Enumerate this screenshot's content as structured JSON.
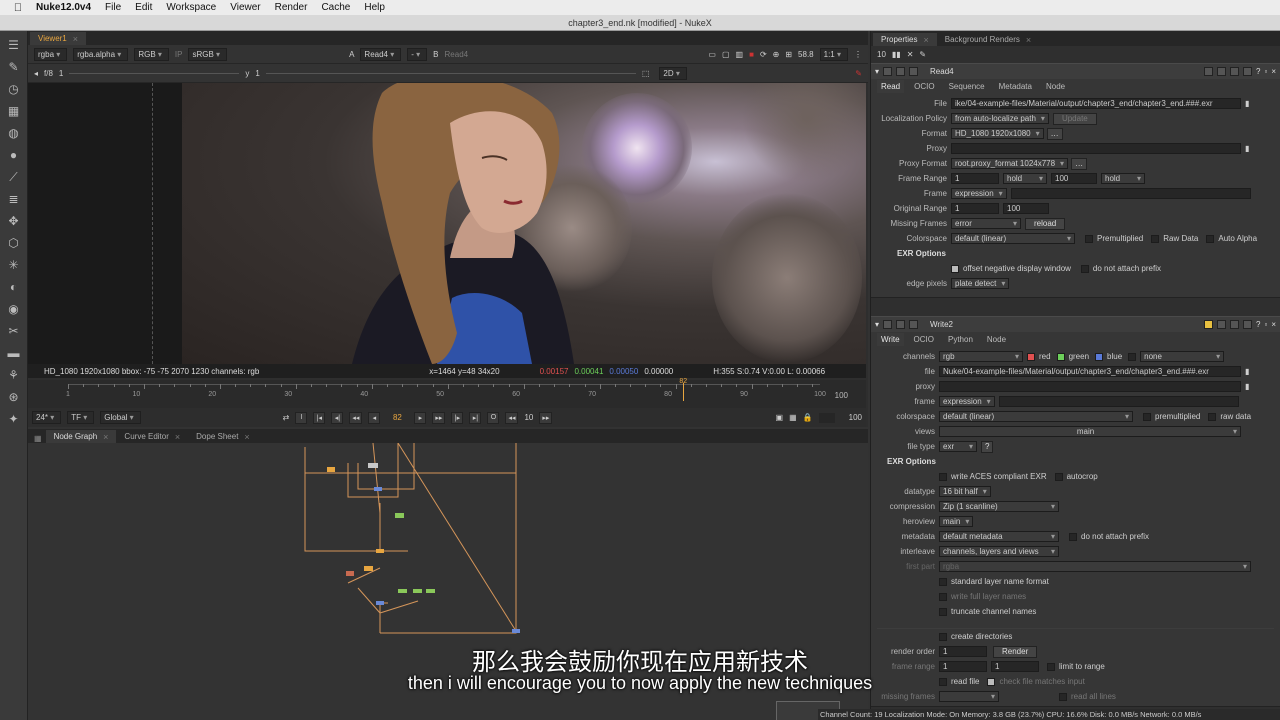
{
  "menubar": {
    "app": "Nuke12.0v4",
    "items": [
      "File",
      "Edit",
      "Workspace",
      "Viewer",
      "Render",
      "Cache",
      "Help"
    ]
  },
  "window_title": "chapter3_end.nk [modified] - NukeX",
  "viewer": {
    "tab": "Viewer1",
    "channels": "rgba",
    "alpha": "rgba.alpha",
    "rgb": "RGB",
    "ip": "IP",
    "lut": "sRGB",
    "a_label": "A",
    "a_input": "Read4",
    "a_op": "-",
    "b_label": "B",
    "b_input": "Read4",
    "fstop": "f/8",
    "gain": "1",
    "y_label": "y",
    "gamma": "1",
    "zoom": "58.8",
    "ratio": "1:1",
    "view_mode": "2D",
    "info_left": "HD_1080 1920x1080  bbox: -75 -75 2070 1230 channels: rgb",
    "info_coords": "x=1464 y=48 34x20",
    "info_r": "0.00157",
    "info_g": "0.00041",
    "info_b": "0.00050",
    "info_a": "0.00000",
    "info_hsv": "H:355 S:0.74 V:0.00  L: 0.00066"
  },
  "timeline": {
    "start": 1,
    "end": 100,
    "current": 82,
    "ticks": [
      "1",
      "10",
      "20",
      "30",
      "40",
      "50",
      "60",
      "70",
      "80",
      "90",
      "100"
    ],
    "end_label": "100"
  },
  "playbar": {
    "fps": "24*",
    "tf": "TF",
    "global": "Global",
    "frame": "82",
    "step": "10",
    "end": "100"
  },
  "nodegraph": {
    "tabs": [
      "Node Graph",
      "Curve Editor",
      "Dope Sheet"
    ]
  },
  "properties": {
    "tabs": [
      "Properties",
      "Background Renders"
    ],
    "max_panels": "10",
    "read_node": {
      "name": "Read4",
      "tabs": [
        "Read",
        "OCIO",
        "Sequence",
        "Metadata",
        "Node"
      ],
      "file_label": "File",
      "file": "ike/04-example-files/Material/output/chapter3_end/chapter3_end.###.exr",
      "localization_label": "Localization Policy",
      "localization": "from auto-localize path",
      "update": "Update",
      "format_label": "Format",
      "format": "HD_1080 1920x1080",
      "proxy_label": "Proxy",
      "proxy_format_label": "Proxy Format",
      "proxy_format": "root.proxy_format 1024x778",
      "frame_range_label": "Frame Range",
      "frame_start": "1",
      "frame_start_mode": "hold",
      "frame_end": "100",
      "frame_end_mode": "hold",
      "frame_label": "Frame",
      "frame_mode": "expression",
      "original_range_label": "Original Range",
      "orig_start": "1",
      "orig_end": "100",
      "missing_label": "Missing Frames",
      "missing": "error",
      "reload": "reload",
      "colorspace_label": "Colorspace",
      "colorspace": "default (linear)",
      "premultiplied": "Premultiplied",
      "raw_data": "Raw Data",
      "auto_alpha": "Auto Alpha",
      "exr_options": "EXR Options",
      "offset_neg": "offset negative display window",
      "no_prefix": "do not attach prefix",
      "edge_label": "edge pixels",
      "edge": "plate detect"
    },
    "write_node": {
      "name": "Write2",
      "tabs": [
        "Write",
        "OCIO",
        "Python",
        "Node"
      ],
      "channels_label": "channels",
      "channels": "rgb",
      "red": "red",
      "green": "green",
      "blue": "blue",
      "none": "none",
      "file_label": "file",
      "file": "Nuke/04-example-files/Material/output/chapter3_end/chapter3_end.###.exr",
      "proxy_label": "proxy",
      "frame_label": "frame",
      "frame": "expression",
      "colorspace_label": "colorspace",
      "colorspace": "default (linear)",
      "premultiplied": "premultiplied",
      "raw_data": "raw data",
      "views_label": "views",
      "views": "main",
      "file_type_label": "file type",
      "file_type": "exr",
      "help": "?",
      "exr_options": "EXR Options",
      "write_aces": "write ACES compliant EXR",
      "autocrop": "autocrop",
      "datatype_label": "datatype",
      "datatype": "16 bit half",
      "compression_label": "compression",
      "compression": "Zip (1 scanline)",
      "heroview_label": "heroview",
      "heroview": "main",
      "metadata_label": "metadata",
      "metadata": "default metadata",
      "no_prefix": "do not attach prefix",
      "interleave_label": "interleave",
      "interleave": "channels, layers and views",
      "first_part_label": "first part",
      "first_part": "rgba",
      "std_layer": "standard layer name format",
      "full_layer": "write full layer names",
      "truncate": "truncate channel names",
      "create_dirs": "create directories",
      "render_order_label": "render order",
      "render_order": "1",
      "render": "Render",
      "frame_range_label": "frame range",
      "range_start": "1",
      "range_end": "1",
      "limit_range": "limit to range",
      "read_file": "read file",
      "check_file": "check file matches input",
      "missing_frames_label": "missing frames",
      "read_all_lines": "read all lines"
    }
  },
  "subtitles": {
    "zh": "那么我会鼓励你现在应用新技术",
    "en": "then i will encourage you to now apply the new techniques"
  },
  "status_bar": "Channel Count: 19  Localization Mode: On  Memory: 3.8 GB (23.7%)  CPU: 16.6%  Disk: 0.0 MB/s  Network: 0.0 MB/s",
  "colors": {
    "accent": "#e8a640",
    "red": "#e05050",
    "green": "#6ccf5a",
    "blue": "#5a7ad8"
  }
}
